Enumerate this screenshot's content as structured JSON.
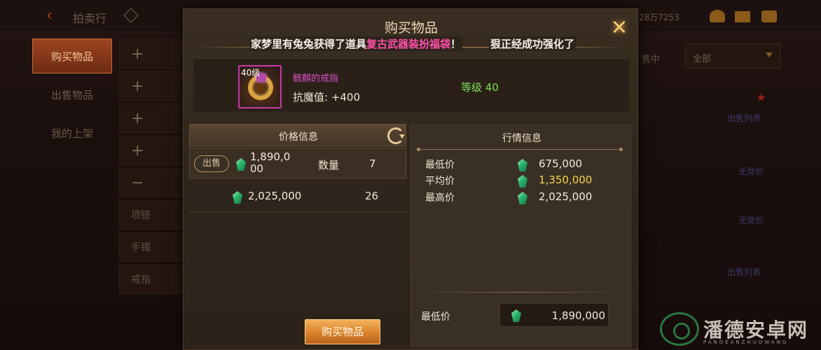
{
  "background": {
    "title": "拍卖行",
    "currency_partial": "28万7253",
    "tabs": [
      "购买物品",
      "出售物品",
      "我的上架"
    ],
    "categories": [
      "+",
      "+",
      "+",
      "+",
      "−",
      "项链",
      "手镯",
      "戒指"
    ],
    "filter_label": "售中",
    "filter_value": "全部",
    "links": [
      "出售列表",
      "无竞价",
      "无竞价",
      "出售列表"
    ]
  },
  "modal": {
    "title": "购买物品",
    "close_icon": "×"
  },
  "news": {
    "prefix": "家梦里有兔兔获得了道具",
    "item": "复古武器装扮福袋",
    "suffix": "！",
    "second": "狠正经成功强化了"
  },
  "item": {
    "level_badge": "40级",
    "name": "骸麒的戒指",
    "stat": "抗魔值: +400",
    "level_text": "等级 40",
    "rarity_color": "#c53aa8"
  },
  "price_info": {
    "title": "价格信息",
    "rows": [
      {
        "tag": "出售",
        "price": "1,890,000",
        "qty_label": "数量",
        "qty": "7"
      },
      {
        "tag": "",
        "price": "2,025,000",
        "qty_label": "",
        "qty": "26"
      }
    ]
  },
  "market_info": {
    "title": "行情信息",
    "rows": [
      {
        "label": "最低价",
        "value": "675,000"
      },
      {
        "label": "平均价",
        "value": "1,350,000"
      },
      {
        "label": "最高价",
        "value": "2,025,000"
      }
    ],
    "min_price_label": "最低价",
    "min_price_value": "1,890,000"
  },
  "buy_button": "购买物品",
  "watermark": {
    "text": "潘德安卓网",
    "sub": "PANDEANZHUOWANG"
  }
}
